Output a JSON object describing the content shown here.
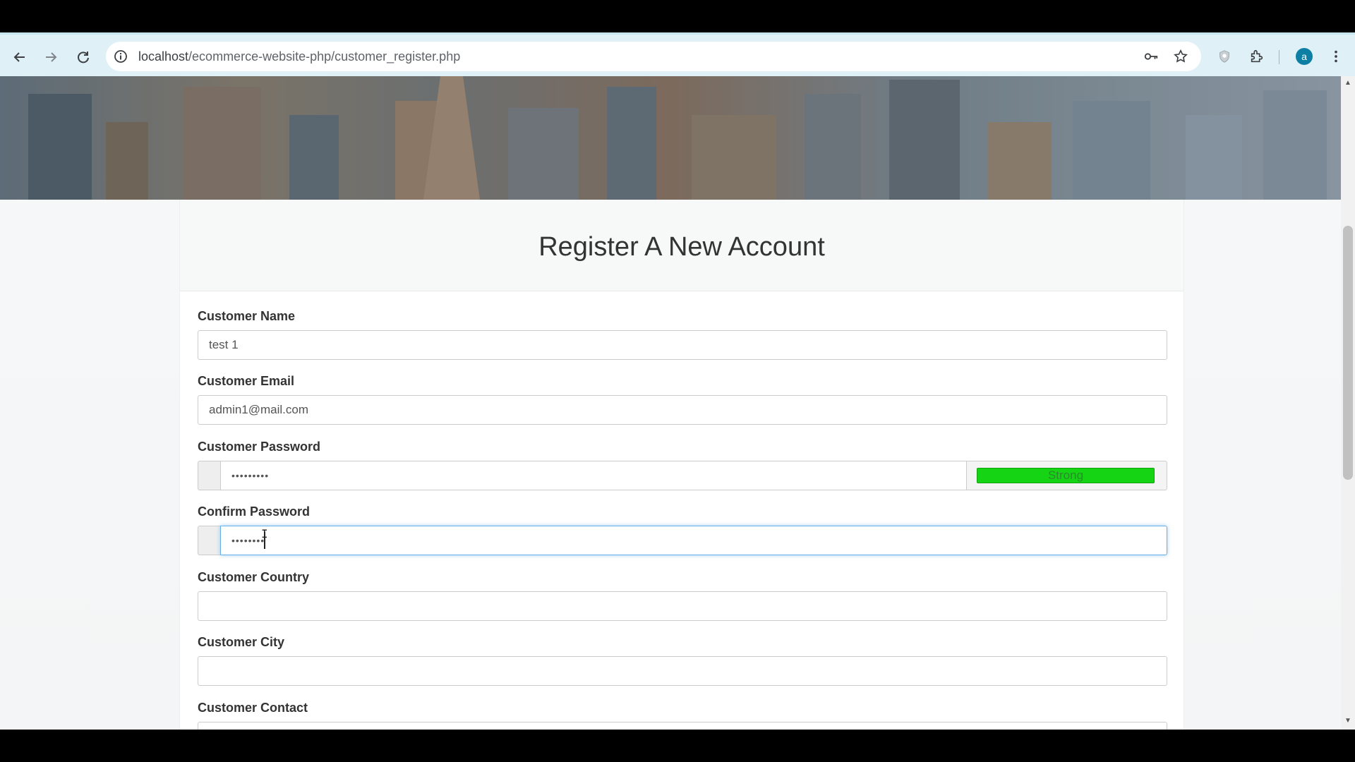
{
  "browser": {
    "url_host": "localhost",
    "url_path": "/ecommerce-website-php/customer_register.php",
    "profile_initial": "a"
  },
  "page": {
    "title": "Register A New Account"
  },
  "form": {
    "name_label": "Customer Name",
    "name_value": "test 1",
    "email_label": "Customer Email",
    "email_value": "admin1@mail.com",
    "password_label": "Customer Password",
    "password_value": "•••••••••",
    "password_strength": "Strong",
    "confirm_label": "Confirm Password",
    "confirm_value": "••••••••",
    "country_label": "Customer Country",
    "country_value": "",
    "city_label": "Customer City",
    "city_value": "",
    "contact_label": "Customer Contact"
  },
  "colors": {
    "strength_strong": "#14d414",
    "focus_border": "#66afe9",
    "toolbar_bg": "#dff0f6"
  }
}
